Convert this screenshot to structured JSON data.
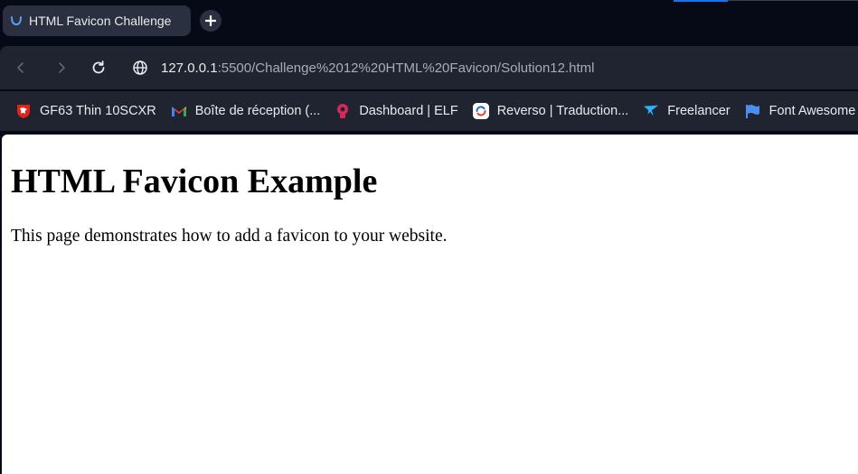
{
  "tabs": [
    {
      "title": "HTML Favicon Challenge",
      "favicon": "smile-icon"
    }
  ],
  "new_tab": {
    "icon": "plus-icon"
  },
  "toolbar": {
    "back_icon": "chevron-left-icon",
    "forward_icon": "chevron-right-icon",
    "reload_icon": "reload-icon",
    "site_info_icon": "globe-icon",
    "url_host": "127.0.0.1",
    "url_rest": ":5500/Challenge%2012%20HTML%20Favicon/Solution12.html"
  },
  "bookmarks": [
    {
      "label": "GF63 Thin 10SCXR",
      "icon": "msi-dragon-icon"
    },
    {
      "label": "Boîte de réception (...",
      "icon": "gmail-icon"
    },
    {
      "label": "Dashboard | ELF",
      "icon": "elf-logo-icon"
    },
    {
      "label": "Reverso | Traduction...",
      "icon": "reverso-icon"
    },
    {
      "label": "Freelancer",
      "icon": "freelancer-bird-icon"
    },
    {
      "label": "Font Awesome",
      "icon": "flag-icon"
    }
  ],
  "page": {
    "heading": "HTML Favicon Example",
    "paragraph": "This page demonstrates how to add a favicon to your website."
  },
  "colors": {
    "frame": "#060a17",
    "toolbar": "#202431",
    "tab_active": "#2b3041",
    "accent": "#1a73e8",
    "page_bg": "#ffffff"
  }
}
